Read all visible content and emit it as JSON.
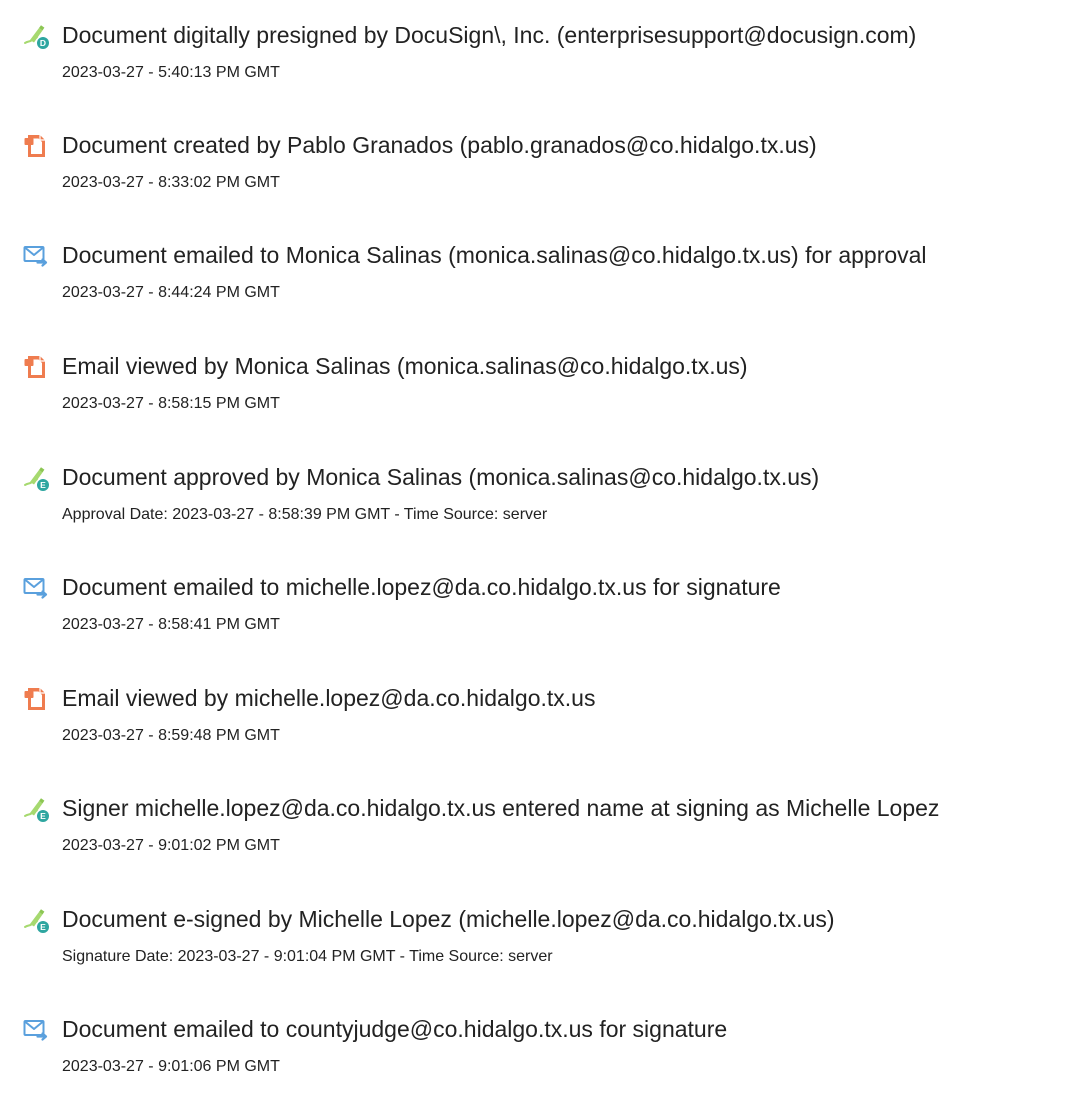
{
  "colors": {
    "sign_pen": "#a6d96f",
    "sign_badge": "#2ea6a0",
    "doc_orange": "#ef7c4f",
    "email_blue": "#5aa0dd"
  },
  "events": [
    {
      "icon": "signature-pen-icon",
      "badge": "D",
      "title": "Document digitally presigned by DocuSign\\, Inc. (enterprisesupport@docusign.com)",
      "detail": "2023-03-27 - 5:40:13 PM GMT"
    },
    {
      "icon": "document-icon",
      "title": "Document created by Pablo Granados (pablo.granados@co.hidalgo.tx.us)",
      "detail": "2023-03-27 - 8:33:02 PM GMT"
    },
    {
      "icon": "email-sent-icon",
      "title": "Document emailed to Monica Salinas (monica.salinas@co.hidalgo.tx.us) for approval",
      "detail": "2023-03-27 - 8:44:24 PM GMT"
    },
    {
      "icon": "document-icon",
      "title": "Email viewed by Monica Salinas (monica.salinas@co.hidalgo.tx.us)",
      "detail": "2023-03-27 - 8:58:15 PM GMT"
    },
    {
      "icon": "signature-pen-icon",
      "badge": "E",
      "title": "Document approved by Monica Salinas (monica.salinas@co.hidalgo.tx.us)",
      "detail": "Approval Date: 2023-03-27 - 8:58:39 PM GMT - Time Source: server"
    },
    {
      "icon": "email-sent-icon",
      "title": "Document emailed to michelle.lopez@da.co.hidalgo.tx.us for signature",
      "detail": "2023-03-27 - 8:58:41 PM GMT"
    },
    {
      "icon": "document-icon",
      "title": "Email viewed by michelle.lopez@da.co.hidalgo.tx.us",
      "detail": "2023-03-27 - 8:59:48 PM GMT"
    },
    {
      "icon": "signature-pen-icon",
      "badge": "E",
      "title": "Signer michelle.lopez@da.co.hidalgo.tx.us entered name at signing as Michelle Lopez",
      "detail": "2023-03-27 - 9:01:02 PM GMT"
    },
    {
      "icon": "signature-pen-icon",
      "badge": "E",
      "title": "Document e-signed by Michelle Lopez (michelle.lopez@da.co.hidalgo.tx.us)",
      "detail": "Signature Date: 2023-03-27 - 9:01:04 PM GMT - Time Source: server"
    },
    {
      "icon": "email-sent-icon",
      "title": "Document emailed to countyjudge@co.hidalgo.tx.us for signature",
      "detail": "2023-03-27 - 9:01:06 PM GMT"
    }
  ]
}
